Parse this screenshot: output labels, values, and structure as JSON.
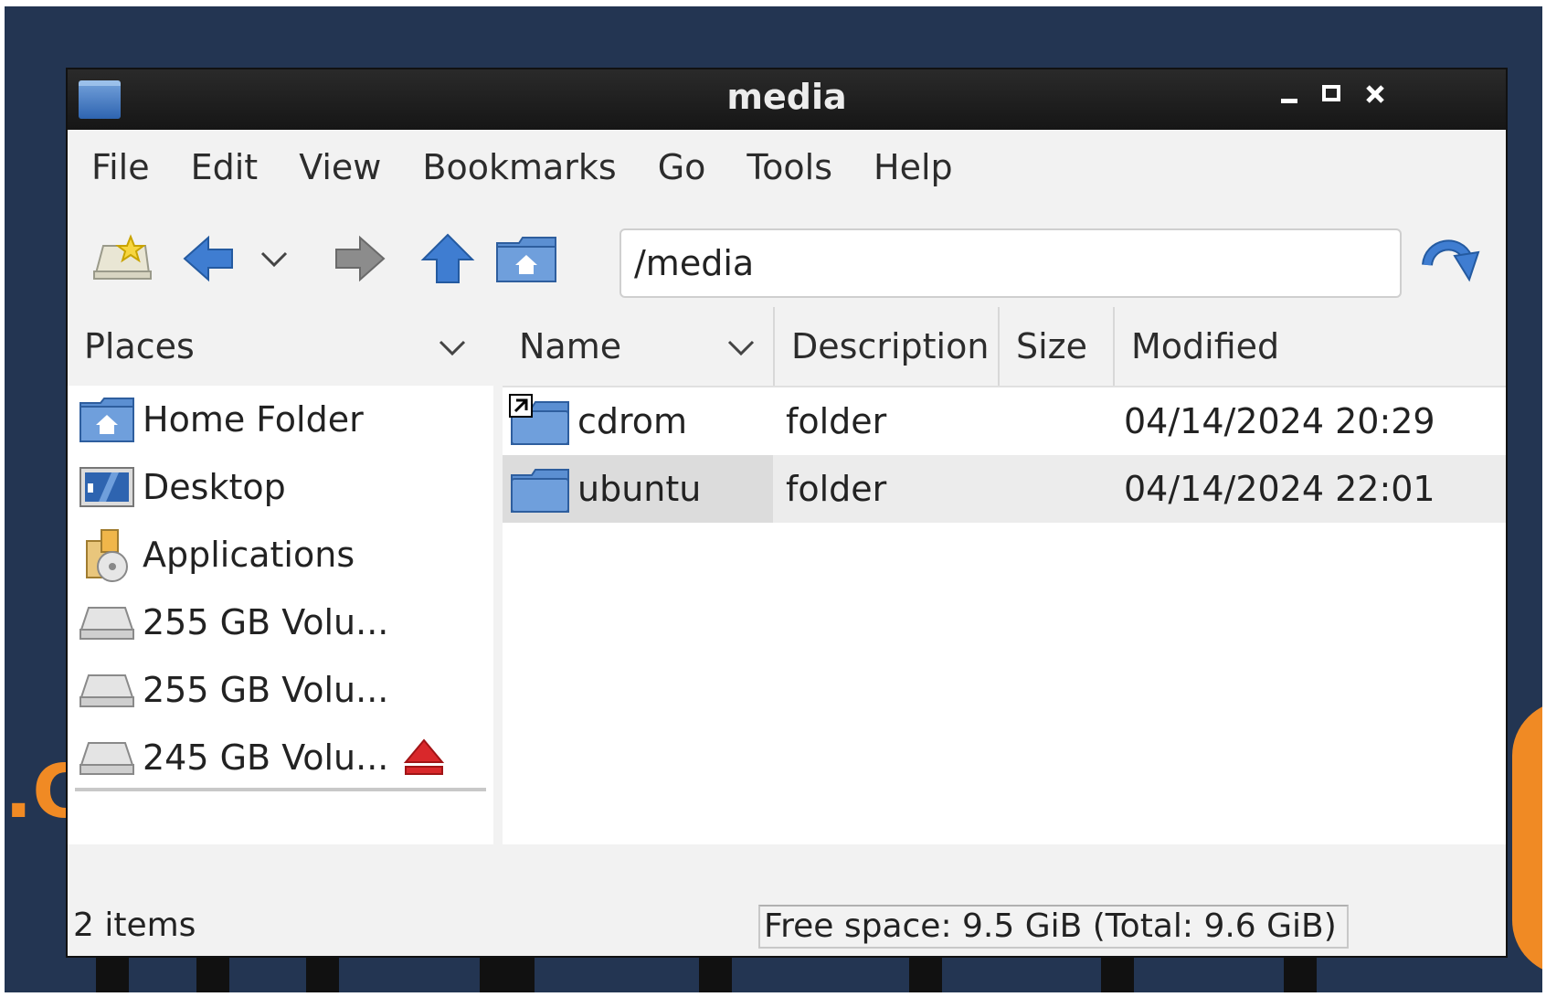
{
  "window": {
    "title": "media"
  },
  "menu": {
    "items": [
      "File",
      "Edit",
      "View",
      "Bookmarks",
      "Go",
      "Tools",
      "Help"
    ]
  },
  "toolbar": {
    "buttons": [
      "new-tab-icon",
      "back-icon",
      "history-dropdown-icon",
      "forward-icon",
      "up-icon",
      "home-icon",
      "go-icon"
    ],
    "address_value": "/media"
  },
  "places": {
    "header": "Places",
    "items": [
      {
        "label": "Home Folder",
        "icon": "home-folder-icon"
      },
      {
        "label": "Desktop",
        "icon": "desktop-icon"
      },
      {
        "label": "Applications",
        "icon": "applications-icon"
      },
      {
        "label": "255 GB Volu...",
        "icon": "drive-icon"
      },
      {
        "label": "255 GB Volu...",
        "icon": "drive-icon"
      },
      {
        "label": "245 GB Volu...",
        "icon": "drive-icon",
        "eject": true
      }
    ]
  },
  "files": {
    "columns": [
      "Name",
      "Description",
      "Size",
      "Modified"
    ],
    "rows": [
      {
        "name": "cdrom",
        "description": "folder",
        "size": "",
        "modified": "04/14/2024 20:29",
        "symlink": true
      },
      {
        "name": "ubuntu",
        "description": "folder",
        "size": "",
        "modified": "04/14/2024 22:01",
        "symlink": false
      }
    ]
  },
  "status": {
    "items": "2 items",
    "free_space": "Free space: 9.5 GiB (Total: 9.6 GiB)"
  },
  "colors": {
    "desktop_bg": "#233552",
    "titlebar": "#1c1c1c",
    "folder_blue": "#3f72b8",
    "eject_red": "#d9282b"
  }
}
